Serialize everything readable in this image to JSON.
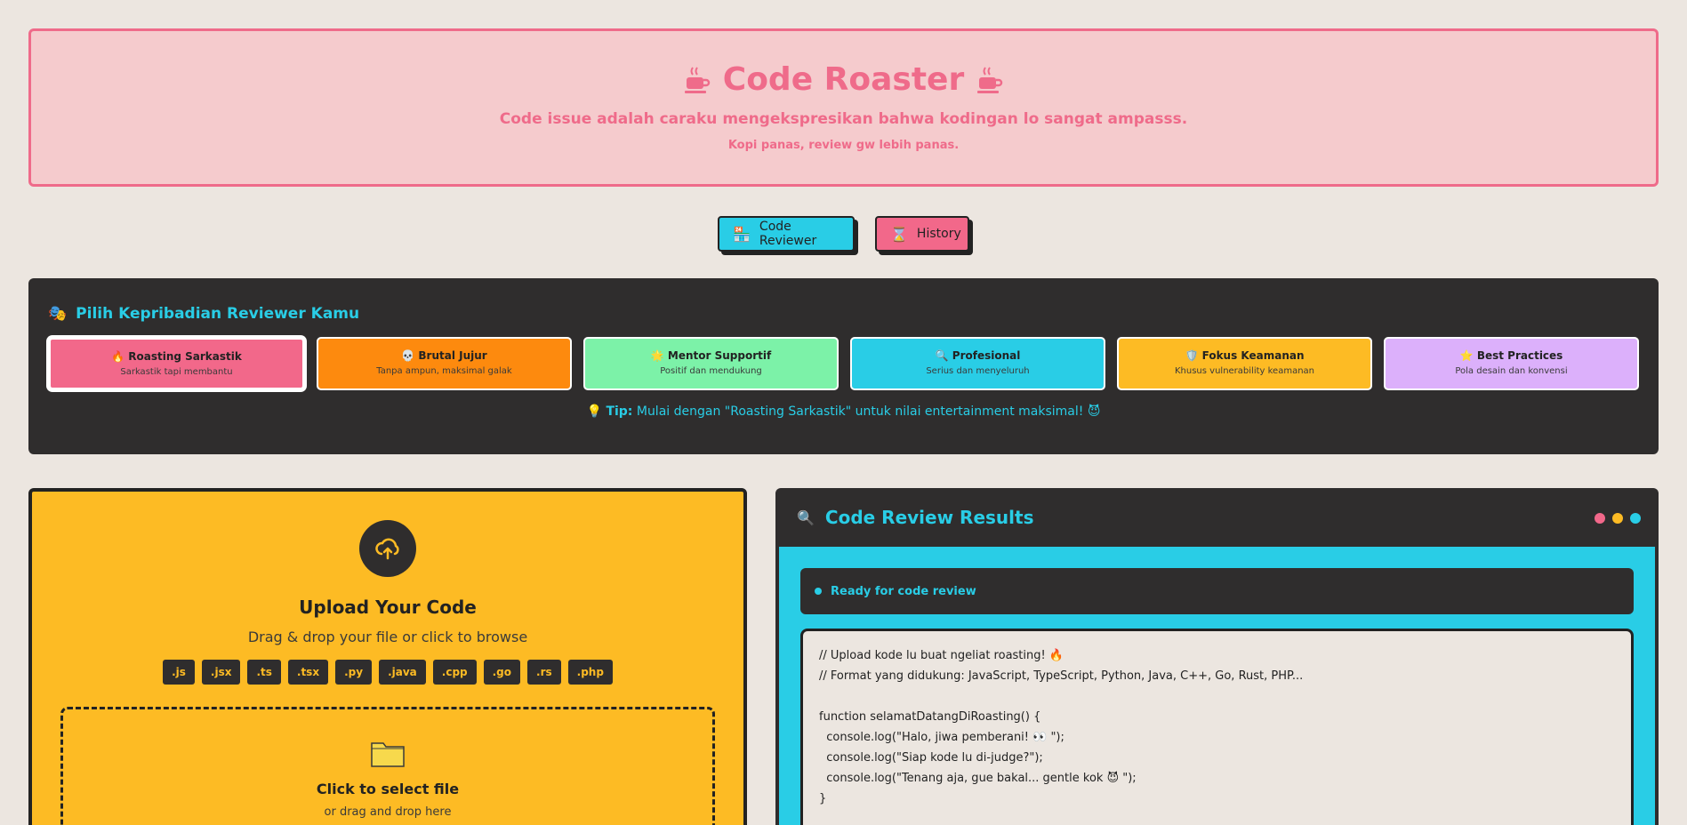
{
  "header": {
    "title": "Code Roaster",
    "subtitle": "Code issue adalah caraku mengekspresikan bahwa kodingan lo sangat ampasss.",
    "tagline": "Kopi panas, review gw lebih panas."
  },
  "nav": {
    "reviewer_icon": "🏪",
    "reviewer_label": "Code Reviewer",
    "history_icon": "⌛",
    "history_label": "History"
  },
  "personality": {
    "icon": "🎭",
    "title": "Pilih Kepribadian Reviewer Kamu",
    "cards": [
      {
        "icon": "🔥",
        "title": "Roasting Sarkastik",
        "desc": "Sarkastik tapi membantu",
        "color": "#f2688a"
      },
      {
        "icon": "💀",
        "title": "Brutal Jujur",
        "desc": "Tanpa ampun, maksimal galak",
        "color": "#fd8a0e"
      },
      {
        "icon": "🌟",
        "title": "Mentor Supportif",
        "desc": "Positif dan mendukung",
        "color": "#7cf2a8"
      },
      {
        "icon": "🔍",
        "title": "Profesional",
        "desc": "Serius dan menyeluruh",
        "color": "#29cde6"
      },
      {
        "icon": "🛡️",
        "title": "Fokus Keamanan",
        "desc": "Khusus vulnerability keamanan",
        "color": "#fdbb24"
      },
      {
        "icon": "⭐",
        "title": "Best Practices",
        "desc": "Pola desain dan konvensi",
        "color": "#dcb0fb"
      }
    ],
    "tip_icon": "💡",
    "tip_label": "Tip:",
    "tip_text": "Mulai dengan \"Roasting Sarkastik\" untuk nilai entertainment maksimal! 😈"
  },
  "upload": {
    "title": "Upload Your Code",
    "subtitle": "Drag & drop your file or click to browse",
    "extensions": [
      ".js",
      ".jsx",
      ".ts",
      ".tsx",
      ".py",
      ".java",
      ".cpp",
      ".go",
      ".rs",
      ".php"
    ],
    "drop_title": "Click to select file",
    "drop_sub": "or drag and drop here"
  },
  "results": {
    "icon": "🔍",
    "title": "Code Review Results",
    "dot_colors": [
      "#f2688a",
      "#fdbb24",
      "#29cde6"
    ],
    "status": "Ready for code review",
    "code_lines": [
      "// Upload kode lu buat ngeliat roasting! 🔥",
      "// Format yang didukung: JavaScript, TypeScript, Python, Java, C++, Go, Rust, PHP...",
      "",
      "function selamatDatangDiRoasting() {",
      "  console.log(\"Halo, jiwa pemberani! 👀 \");",
      "  console.log(\"Siap kode lu di-judge?\");",
      "  console.log(\"Tenang aja, gue bakal... gentle kok 😈 \");",
      "}"
    ]
  }
}
